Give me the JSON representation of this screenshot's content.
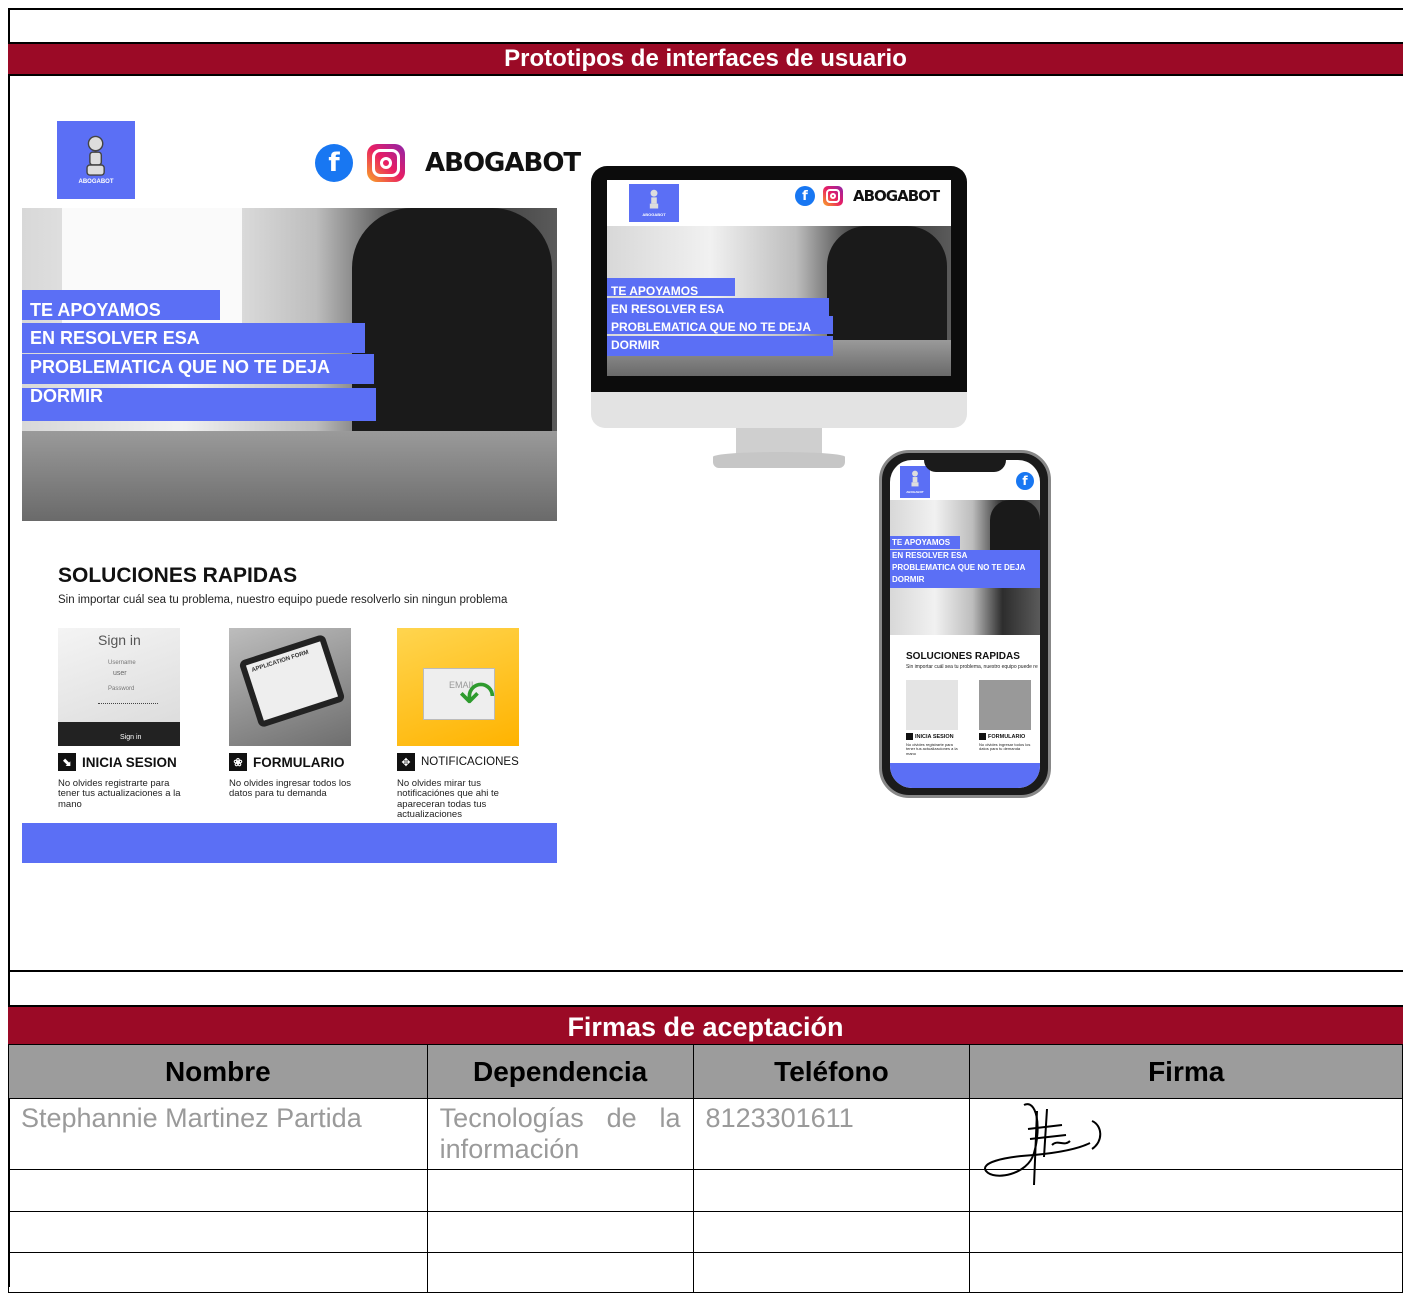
{
  "document": {
    "prototypes_heading": "Prototipos de interfaces de usuario",
    "signatures_heading": "Firmas de aceptación"
  },
  "prototype": {
    "logo_caption": "ABOGABOT",
    "brand": "ABOGABOT",
    "social_icons": [
      "facebook-icon",
      "instagram-icon"
    ],
    "hero_lines": [
      "TE APOYAMOS",
      "EN RESOLVER ESA",
      "PROBLEMATICA QUE NO TE DEJA",
      "DORMIR"
    ],
    "solutions_title": "SOLUCIONES RAPIDAS",
    "solutions_subtitle": "Sin importar cuál sea tu problema, nuestro equipo puede resolverlo sin ningun problema",
    "cards": [
      {
        "title": "INICIA SESION",
        "desc": "No olvides registrarte para tener tus actualizaciones a la mano",
        "img_lines": [
          "Sign in",
          "Username",
          "user",
          "Password",
          "Sign in"
        ]
      },
      {
        "title": "FORMULARIO",
        "desc": "No olvides ingresar todos los datos para tu demanda",
        "img_lines": [
          "APPLICATION FORM"
        ]
      },
      {
        "title": "NOTIFICACIONES",
        "desc": "No olvides mirar tus notificaciónes que ahi te apareceran todas tus actualizaciones",
        "img_lines": [
          "EMAIL"
        ]
      }
    ],
    "phone_solutions_subtitle": "Sin importar cuál sea tu problema, nuestro equipo puede re"
  },
  "colors": {
    "header_bar": "#9b0a26",
    "accent_blue": "#5b6ff5",
    "table_header": "#9c9c9c"
  },
  "signatures": {
    "headers": [
      "Nombre",
      "Dependencia",
      "Teléfono",
      "Firma"
    ],
    "rows": [
      {
        "nombre": "Stephannie Martinez Partida",
        "dependencia": "Tecnologías de la información",
        "telefono": "8123301611",
        "firma": "handwritten-signature"
      },
      {
        "nombre": "",
        "dependencia": "",
        "telefono": "",
        "firma": ""
      },
      {
        "nombre": "",
        "dependencia": "",
        "telefono": "",
        "firma": ""
      },
      {
        "nombre": "",
        "dependencia": "",
        "telefono": "",
        "firma": ""
      }
    ]
  }
}
